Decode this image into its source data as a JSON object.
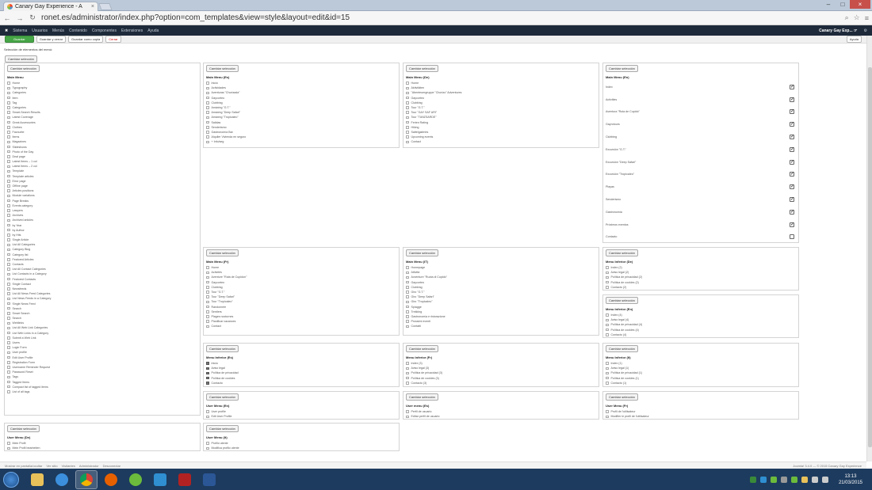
{
  "browser": {
    "tab_title": "Canary Gay Experience - A",
    "url": "ronet.es/administrator/index.php?option=com_templates&view=style&layout=edit&id=15"
  },
  "admin_bar": {
    "items": [
      "Sistema",
      "Usuarios",
      "Menús",
      "Contenido",
      "Componentes",
      "Extensiones",
      "Ayuda"
    ],
    "site_name": "Canary Gay Exp... ☞"
  },
  "toolbar": {
    "save": "Guardar",
    "save_close": "Guardar y cerrar",
    "save_copy": "Guardar como copia",
    "close": "Cerrar",
    "help": "Ayuda"
  },
  "page": {
    "selection_label": "Selección de elementos del menú:",
    "toggle_label": "Cambiar selección"
  },
  "panels": [
    {
      "title": "Main Menu",
      "items": [
        "Home",
        "Typography",
        "Categories",
        "Item",
        "Tag",
        "Categories",
        "Smart-Search Results",
        "Latest Coverage",
        "Great Accessories",
        "Clothes",
        "Favourite",
        "Items",
        "Magazines",
        "Slideshows",
        "Photo of the Day",
        "Deal page",
        "Latest Items – 1 col",
        "Latest Items – 2 col",
        "Template",
        "Template articles",
        "Error page",
        "Offline page",
        "Articles positions",
        "Module variations",
        "Page Breaks",
        "Events category",
        "Lawyers",
        "Archives",
        "Archived articles",
        "by Year",
        "by Author",
        "by Hits",
        "Single Article",
        "List All Categories",
        "Category Blog",
        "Category list",
        "Featured Articles",
        "Contacts",
        "List All Contact Categories",
        "List Contacts in a Category",
        "Featured Contacts",
        "Single Contact",
        "Newsfeeds",
        "List All News Feed Categories",
        "List News Feeds in a Category",
        "Single News Feed",
        "Search",
        "Smart Search",
        "Search",
        "Weblinks",
        "List All Web Link Categories",
        "List Web Links in a Category",
        "Submit a Web Link",
        "Users",
        "Login Form",
        "User profile",
        "Edit User Profile",
        "Registration Form",
        "Username Reminder Request",
        "Password Reset",
        "Tags",
        "Tagged Items",
        "Compact list of tagged items",
        "List of all tags"
      ],
      "checked": []
    },
    {
      "title": "Main Menu (Es)",
      "items": [
        "Inicio",
        "Actividades",
        "Aventuras \"Chorizada\"",
        "Gaycorteo",
        "Clubbing",
        "Amáxing \"G.T.\"",
        "Amáxing \"Deep Safari\"",
        "Amáxing \"Tropicaleo\"",
        "Salidas",
        "Senderismo",
        "Gastronomía Bar",
        "Alquiler Vivienda en seguro",
        "+ Info/seg"
      ],
      "checked": []
    },
    {
      "title": "Main Menu (De)",
      "items": [
        "Home",
        "Aktivitäten",
        "\"Abenteuergruppe \"Chorizo\" Adventures",
        "Gaycorteo",
        "Clubbing",
        "Tour \"G.T.\"",
        "Tour \"GAY SAF ARI\"",
        "Tour \"TANZSARDE\"",
        "Ferien Rating",
        "Hiking",
        "Sattelgaleries",
        "Upcoming events",
        "Contact"
      ],
      "checked": []
    },
    {
      "title": "Main Menu (En)",
      "items": [
        "Index",
        "Activities",
        "Aventura \"Ruta de Cupido\"",
        "Gayrotours",
        "Clubbing",
        "Excursión \"G.T.\"",
        "Excursión \"Deep Safari\"",
        "Excursión \"Tropicaleo\"",
        "Playas",
        "Senderismo",
        "Gastronomía",
        "Próximos eventos",
        "Contacto"
      ],
      "checked": [
        "Index",
        "Activities",
        "Aventura \"Ruta de Cupido\"",
        "Gayrotours",
        "Clubbing",
        "Excursión \"G.T.\"",
        "Excursión \"Deep Safari\"",
        "Excursión \"Tropicaleo\"",
        "Playas",
        "Senderismo",
        "Gastronomía",
        "Próximos eventos"
      ]
    },
    {
      "title": "Main Menu (Fr)",
      "items": [
        "Home",
        "Activités",
        "Aventure \"Ruta de Cupidon\"",
        "Gaycorteo",
        "Clubbing",
        "Tour \"G.T.\"",
        "Tour \"Deep Safari\"",
        "Tour \"Tropicaleo\"",
        "Randonnée",
        "Sentiers",
        "Plages nocturnes",
        "Planificar vacances",
        "Contact"
      ],
      "checked": []
    },
    {
      "title": "Main Menu (IT)",
      "items": [
        "Homepage",
        "Attività",
        "Avventure \"Ruota di Cupido\"",
        "Gaycorteo",
        "Clubbing",
        "Giro \"G.T.\"",
        "Giro \"Deep Safari\"",
        "Giro \"Tropicaleo\"",
        "Spiagge",
        "Trekking",
        "Gastronomia e ristorazione",
        "Prossimi eventi",
        "Contatti"
      ],
      "checked": []
    },
    {
      "title": "Menu Inferior (De)",
      "items": [
        "Index (2)",
        "Aviso legal (2)",
        "Política de privacidad (2)",
        "Política de cookies (2)",
        "Contacto (2)"
      ],
      "checked": []
    },
    {
      "title": "Menu Inferior (En)",
      "items": [
        "Index (4)",
        "Aviso legal (4)",
        "Política de privacidad (4)",
        "Política de cookies (4)",
        "Contacto (4)"
      ],
      "checked": []
    },
    {
      "title": "Menu Inferior (Es)",
      "items": [
        "Inicio",
        "Aviso legal",
        "Política de privacidad",
        "Política de cookies",
        "Contacto"
      ],
      "checked": [
        "Inicio",
        "Aviso legal",
        "Política de privacidad",
        "Política de cookies",
        "Contacto"
      ]
    },
    {
      "title": "Menu Inferior (Fr)",
      "items": [
        "Index (3)",
        "Aviso legal (3)",
        "Política de privacidad (3)",
        "Política de cookies (3)",
        "Contacto (3)"
      ],
      "checked": []
    },
    {
      "title": "Menu Inferior (It)",
      "items": [
        "Index (1)",
        "Aviso legal (1)",
        "Política de privacidad (1)",
        "Política de cookies (1)",
        "Contacto (1)"
      ],
      "checked": []
    },
    {
      "title": "User Menu (De)",
      "items": [
        "Mein Profil",
        "Mein Profil bearbeiten"
      ],
      "checked": []
    },
    {
      "title": "User Menu (En)",
      "items": [
        "User profile",
        "Edit User Profile"
      ],
      "checked": []
    },
    {
      "title": "User menu (Es)",
      "items": [
        "Perfil de usuario",
        "Editar perfil de usuario"
      ],
      "checked": []
    },
    {
      "title": "User Menu (Fr)",
      "items": [
        "Profil de l'utilisateur",
        "Modifier le profil de l'utilisateur"
      ],
      "checked": []
    },
    {
      "title": "User Menu (It)",
      "items": [
        "Profilo utente",
        "Modifica profilo utente"
      ],
      "checked": []
    }
  ],
  "status_bar": {
    "items": [
      "Mostrar en pantalla/ocultar",
      "Ver sitio",
      "Visitantes",
      "Administrador",
      "Desconectar"
    ],
    "right": "Joomla! 3.4.0 — © 2015 Canary Gay Experience"
  },
  "taskbar": {
    "time": "13:13",
    "date": "21/03/2015"
  },
  "colors": {
    "admin_bar": "#1e2a3a",
    "save_green": "#46a546",
    "taskbar": "#1d3b5e",
    "tab_close_red": "#c7504b"
  }
}
